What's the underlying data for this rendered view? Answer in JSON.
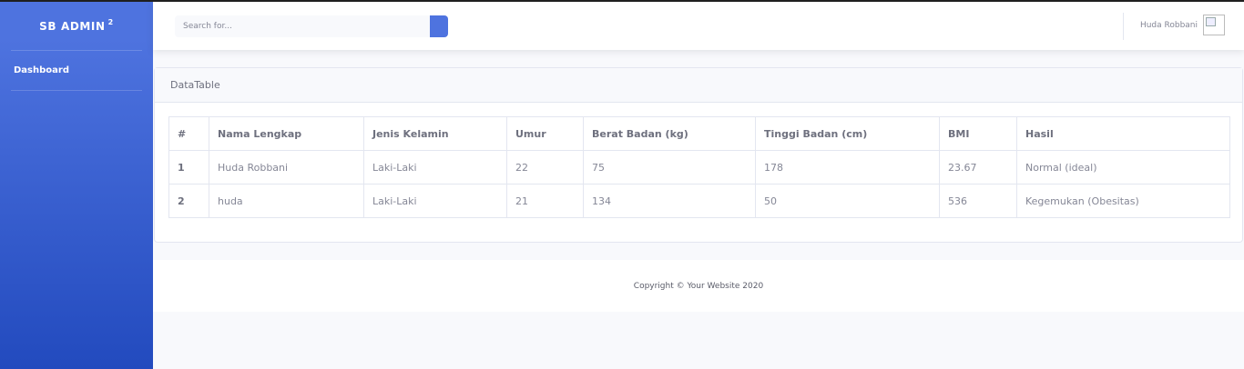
{
  "sidebar": {
    "brand": "SB ADMIN",
    "brand_sup": "2",
    "items": [
      {
        "label": "Dashboard"
      }
    ]
  },
  "topbar": {
    "search_placeholder": "Search for...",
    "user_name": "Huda Robbani"
  },
  "card": {
    "title": "DataTable",
    "columns": [
      "#",
      "Nama Lengkap",
      "Jenis Kelamin",
      "Umur",
      "Berat Badan (kg)",
      "Tinggi Badan (cm)",
      "BMI",
      "Hasil"
    ],
    "rows": [
      [
        "1",
        "Huda Robbani",
        "Laki-Laki",
        "22",
        "75",
        "178",
        "23.67",
        "Normal (ideal)"
      ],
      [
        "2",
        "huda",
        "Laki-Laki",
        "21",
        "134",
        "50",
        "536",
        "Kegemukan (Obesitas)"
      ]
    ]
  },
  "footer": {
    "copyright": "Copyright © Your Website 2020"
  },
  "colors": {
    "primary": "#4e73df",
    "primary_dark": "#224abe",
    "text_muted": "#858796"
  }
}
